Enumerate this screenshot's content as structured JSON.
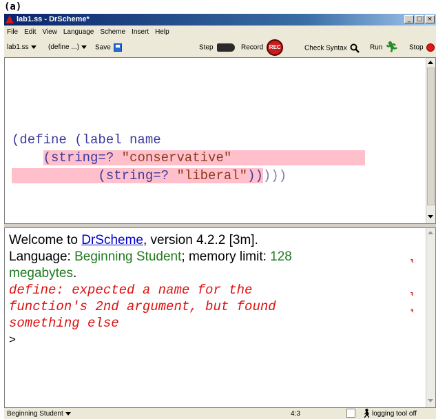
{
  "figure_label": "(a)",
  "window": {
    "title": "lab1.ss - DrScheme*"
  },
  "menu": [
    "File",
    "Edit",
    "View",
    "Language",
    "Scheme",
    "Insert",
    "Help"
  ],
  "toolbar": {
    "file_dropdown": "lab1.ss",
    "define_dropdown": "(define ...)",
    "save": "Save",
    "step": "Step",
    "record": "Record",
    "rec_badge": "REC",
    "check_syntax": "Check Syntax",
    "run": "Run",
    "stop": "Stop"
  },
  "editor": {
    "line1": "(define (label name",
    "line2_open": "(string=? ",
    "line2_str": "\"conservative\"",
    "line3_open": "(string=? ",
    "line3_str": "\"liberal\"",
    "line3_close": "))",
    "line3_tail": ")))"
  },
  "repl": {
    "welcome_prefix": "Welcome to ",
    "welcome_link": "DrScheme",
    "welcome_suffix": ", version 4.2.2 [3m].",
    "lang_prefix": "Language: ",
    "lang_name": "Beginning Student",
    "lang_mid": "; memory limit: ",
    "mem_value": "128",
    "mem_unit": "megabytes",
    "mem_period": ".",
    "error_line1": "define: expected a name for the",
    "error_line2": "function's 2nd argument, but found",
    "error_line3": "something else",
    "prompt": ">"
  },
  "statusbar": {
    "language": "Beginning Student",
    "position": "4:3",
    "logging": "logging tool off"
  },
  "colors": {
    "highlight": "#ffc0cb",
    "error_text": "#dd1111",
    "green_text": "#1f7a1f"
  }
}
